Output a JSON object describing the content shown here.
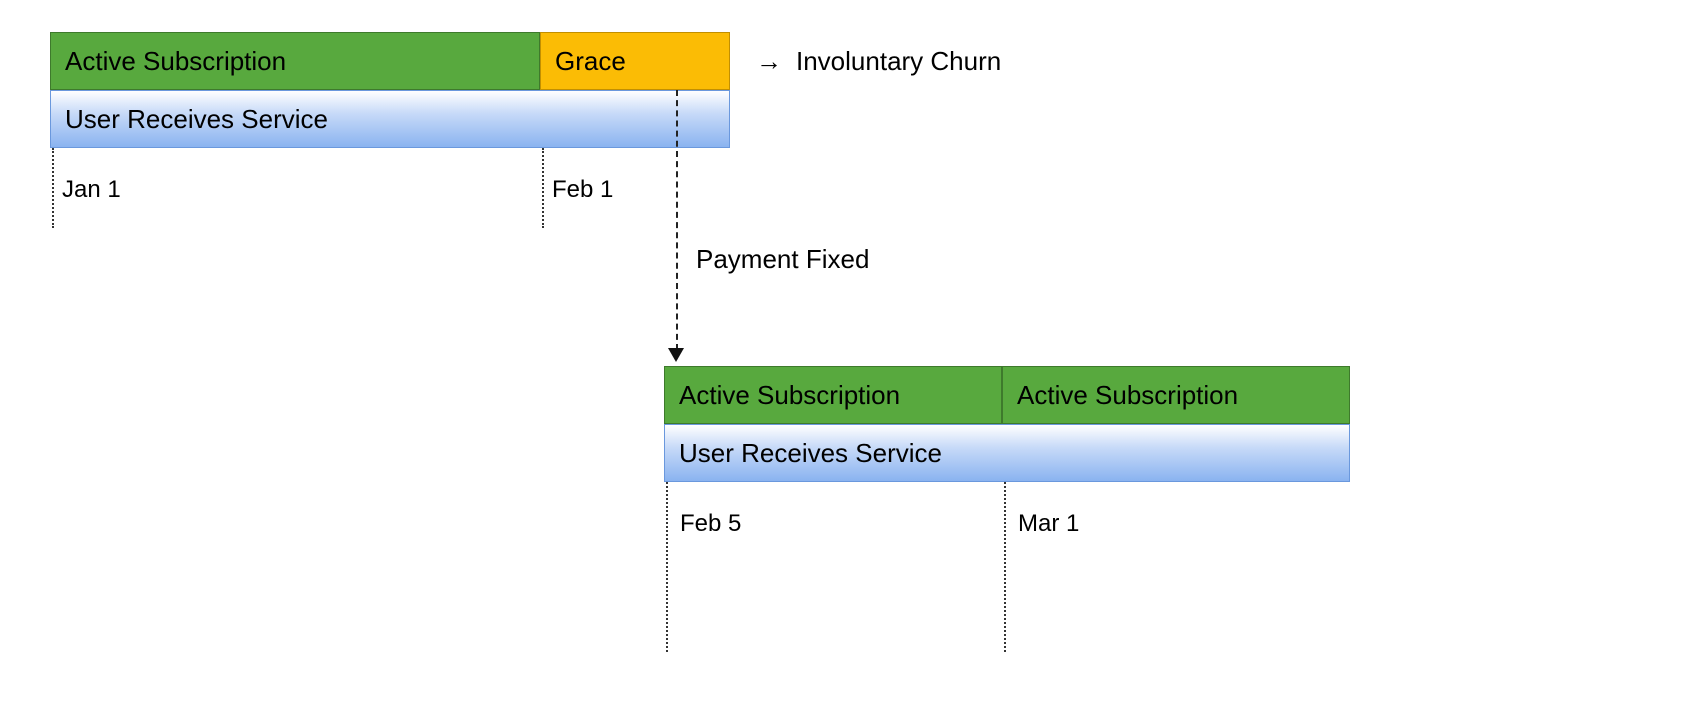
{
  "top": {
    "active_label": "Active Subscription",
    "grace_label": "Grace",
    "service_label": "User Receives Service",
    "date1": "Jan 1",
    "date2": "Feb 1",
    "churn_arrow": "→",
    "churn_text": "Involuntary Churn"
  },
  "middle": {
    "payment_fixed": "Payment Fixed"
  },
  "bottom": {
    "active1_label": "Active Subscription",
    "active2_label": "Active Subscription",
    "service_label": "User Receives Service",
    "date1": "Feb 5",
    "date2": "Mar 1"
  },
  "colors": {
    "green": "#58a93e",
    "yellow": "#fbbc05",
    "blue": "#8ab3f0"
  }
}
